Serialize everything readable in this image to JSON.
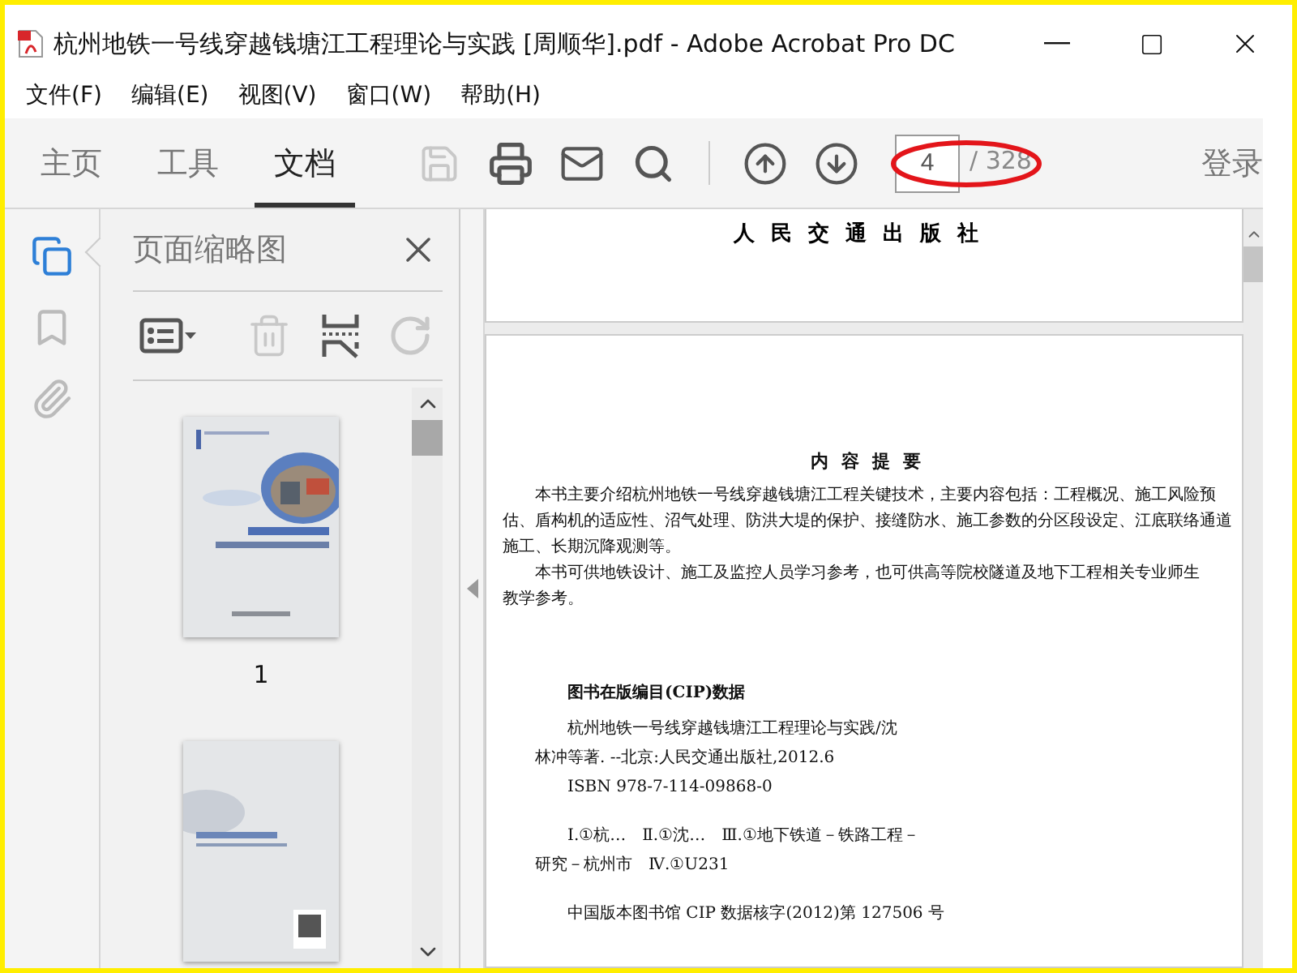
{
  "window": {
    "title": "杭州地铁一号线穿越钱塘江工程理论与实践 [周顺华].pdf - Adobe Acrobat Pro DC"
  },
  "menu": [
    "文件(F)",
    "编辑(E)",
    "视图(V)",
    "窗口(W)",
    "帮助(H)"
  ],
  "toolbar": {
    "tabs": [
      {
        "label": "主页",
        "selected": false
      },
      {
        "label": "工具",
        "selected": false
      },
      {
        "label": "文档",
        "selected": true
      }
    ],
    "tools": [
      {
        "kind": "save",
        "disabled": true
      },
      {
        "kind": "print",
        "disabled": false
      },
      {
        "kind": "mail",
        "disabled": false
      },
      {
        "kind": "search",
        "disabled": false
      }
    ],
    "nav": [
      {
        "kind": "previous"
      },
      {
        "kind": "next"
      }
    ],
    "page_field": {
      "value": "4"
    },
    "page_count": "/ 328",
    "sign_in": "登录"
  },
  "left_rail": [
    {
      "kind": "pages",
      "selected": true
    },
    {
      "kind": "bookmarks",
      "selected": false
    },
    {
      "kind": "attachments",
      "selected": false
    }
  ],
  "thumbnail_panel": {
    "title": "页面缩略图",
    "tools": [
      {
        "kind": "options",
        "disabled": false
      },
      {
        "kind": "delete",
        "disabled": true
      },
      {
        "kind": "insert",
        "disabled": false
      },
      {
        "kind": "rotate",
        "disabled": true
      }
    ],
    "thumbnails": [
      {
        "kind": "picture",
        "label": "1"
      },
      {
        "kind": "picture"
      }
    ]
  },
  "document": {
    "publisher": "人民交通出版社",
    "abstract_title": "内容提要",
    "abstract_lines": [
      {
        "text": "本书主要介绍杭州地铁一号线穿越钱塘江工程关键技术，主要内容包括：工程概况、施工风险预",
        "indent": true
      },
      {
        "text": "估、盾构机的适应性、沼气处理、防洪大堤的保护、接缝防水、施工参数的分区段设定、江底联络通道",
        "indent": false
      },
      {
        "text": "施工、长期沉降观测等。",
        "indent": false
      },
      {
        "text": "本书可供地铁设计、施工及监控人员学习参考，也可供高等院校隧道及地下工程相关专业师生",
        "indent": true
      },
      {
        "text": "教学参考。",
        "indent": false
      }
    ],
    "cip_title": "图书在版编目(CIP)数据",
    "cip_lines": [
      {
        "text": "杭州地铁一号线穿越钱塘江工程理论与实践/沈",
        "indent": true,
        "spaced": false
      },
      {
        "text": "林冲等著. --北京:人民交通出版社,2012.6",
        "indent": false,
        "spaced": false
      },
      {
        "text": "ISBN 978-7-114-09868-0",
        "indent": true,
        "spaced": false
      },
      {
        "text": "Ⅰ.①杭…　Ⅱ.①沈…　Ⅲ.①地下铁道－铁路工程－",
        "indent": true,
        "spaced": true
      },
      {
        "text": "研究－杭州市　Ⅳ.①U231",
        "indent": false,
        "spaced": false
      },
      {
        "text": "中国版本图书馆 CIP 数据核字(2012)第 127506 号",
        "indent": true,
        "spaced": true
      }
    ]
  }
}
